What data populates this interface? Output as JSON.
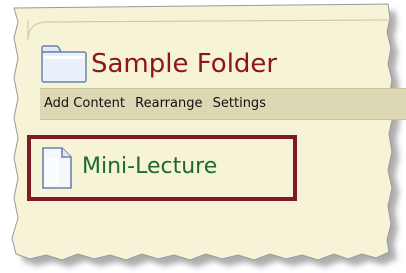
{
  "folder": {
    "icon": "folder-icon",
    "title": "Sample Folder"
  },
  "toolbar": {
    "items": [
      {
        "label": "Add Content"
      },
      {
        "label": "Rearrange"
      },
      {
        "label": "Settings"
      }
    ]
  },
  "content_items": [
    {
      "icon": "document-icon",
      "label": "Mini-Lecture",
      "highlighted": true
    }
  ],
  "colors": {
    "page_background": "#f6f3d6",
    "folder_title": "#8c1717",
    "toolbar_background": "#dcd8b4",
    "item_link": "#1c6b2a",
    "highlight_border": "#7d1a22"
  }
}
